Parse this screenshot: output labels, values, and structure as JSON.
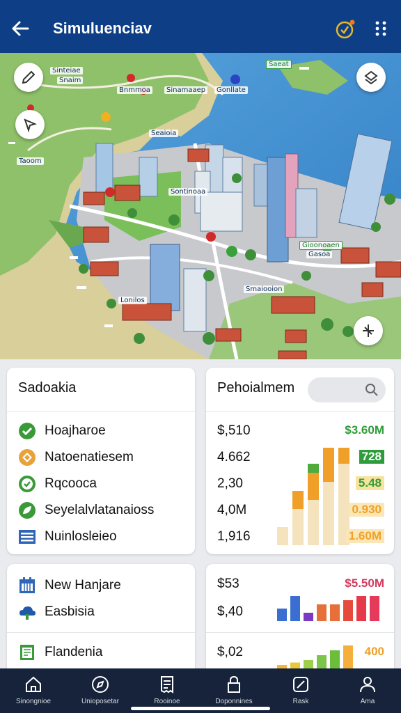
{
  "appbar": {
    "title": "Simuluenciav",
    "back_icon": "arrow-left-icon",
    "timer_icon": "stopwatch-icon",
    "more_icon": "more-vertical-icon"
  },
  "map": {
    "labels": [
      "Sinteiae",
      "Snaim",
      "Bnmmoa",
      "Sinamaaep",
      "Gonllate",
      "Saeat",
      "Seaioia",
      "Taoom",
      "Sontinoaa",
      "Gioonoaen",
      "Smaiooion",
      "Lonilos",
      "Gasoa"
    ]
  },
  "card_left": {
    "title": "Sadoakia",
    "items": [
      {
        "label": "Hoajharoe",
        "icon": "check-circle-icon",
        "color": "#3a9a3a"
      },
      {
        "label": "Natoenatiesem",
        "icon": "diamond-badge-icon",
        "color": "#e7a23a"
      },
      {
        "label": "Rqcooca",
        "icon": "check-circle-icon",
        "color": "#3a9a3a"
      },
      {
        "label": "Seyelalvlatanaioss",
        "icon": "leaf-badge-icon",
        "color": "#3a9a3a"
      },
      {
        "label": "Nuinlosleieo",
        "icon": "list-icon",
        "color": "#2f66b8"
      }
    ]
  },
  "card_right": {
    "title": "Pehoialmem",
    "search_placeholder": "",
    "values": [
      "$,510",
      "4.662",
      "2,30",
      "4,0M",
      "1,916"
    ],
    "bar_labels": [
      "$3.60M",
      "728",
      "5.48",
      "0.930",
      "1.60M"
    ],
    "chart_values": [
      [
        2,
        0,
        0
      ],
      [
        4,
        2,
        0
      ],
      [
        5,
        3,
        1
      ],
      [
        7,
        4,
        2
      ],
      [
        9,
        6,
        4
      ]
    ]
  },
  "card_left2": {
    "items": [
      {
        "label": "New Hanjare",
        "icon": "calendar-icon",
        "color": "#2f66b8"
      },
      {
        "label": "Easbisia",
        "icon": "cloud-icon",
        "color": "#1e5aa8"
      },
      {
        "label": "Flandenia",
        "icon": "document-icon",
        "color": "#3a9a3a"
      }
    ]
  },
  "card_right2": {
    "values": [
      "$53",
      "$,40",
      "$,02"
    ],
    "labels": [
      "$5.50M",
      "400"
    ],
    "bars1": [
      3,
      6,
      2,
      4,
      4,
      5,
      6,
      6
    ],
    "bars1_colors": [
      "#3a6fd1",
      "#3a6fd1",
      "#7a3ac4",
      "#e66f3a",
      "#e66f3a",
      "#e64a3a",
      "#e63a4a",
      "#e63a5a"
    ],
    "bars2": [
      1,
      1.5,
      2,
      3,
      4,
      5
    ],
    "bars2_colors": [
      "#f5b53a",
      "#e9c63a",
      "#9fcf4a",
      "#7cc44a",
      "#6cbd3a",
      "#f4b03a"
    ]
  },
  "bottom_nav": [
    {
      "label": "Sinongnioe",
      "icon": "home-icon"
    },
    {
      "label": "Unioposetar",
      "icon": "compass-icon"
    },
    {
      "label": "Rooinoe",
      "icon": "receipt-icon"
    },
    {
      "label": "Doponnines",
      "icon": "lock-icon"
    },
    {
      "label": "Rask",
      "icon": "chart-line-icon"
    },
    {
      "label": "Ama",
      "icon": "user-icon"
    }
  ],
  "colors": {
    "appbar": "#0e3f86",
    "sea": "#3f8fd0",
    "green_text": "#2e9c3a",
    "red_text": "#d23a5e",
    "orange": "#f0a028"
  }
}
